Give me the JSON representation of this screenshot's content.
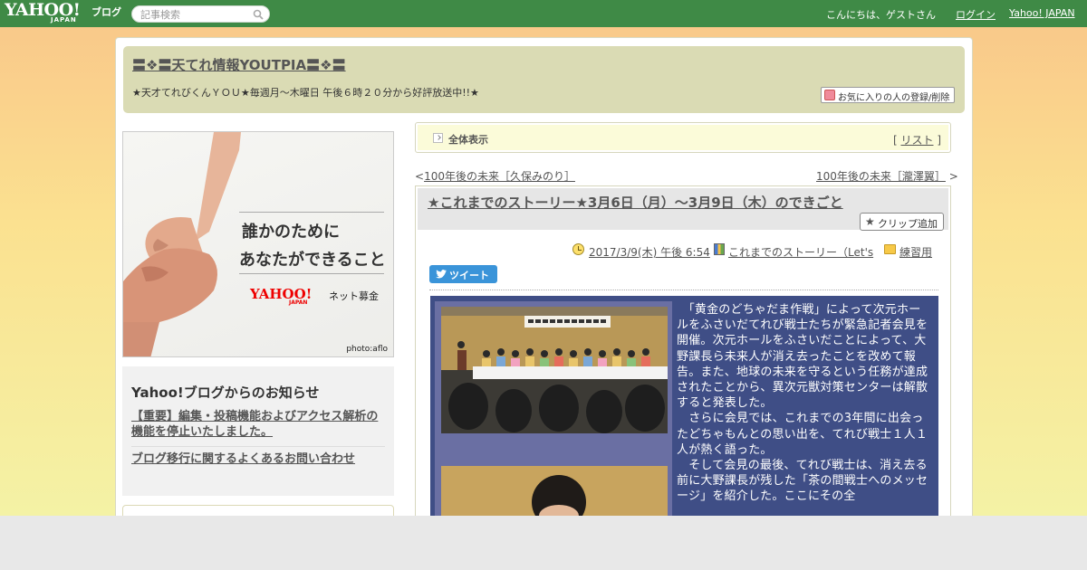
{
  "topbar": {
    "logo_main": "YAHOO!",
    "logo_sub": "JAPAN",
    "logo_blog": "ブログ",
    "search_placeholder": "記事検索",
    "greeting": "こんにちは、ゲストさん",
    "login": "ログイン",
    "yahoo_japan": "Yahoo! JAPAN"
  },
  "header": {
    "blog_title": "〓❖〓天てれ情報YOUTPIA〓❖〓",
    "description": "★天才てれびくんＹＯＵ★毎週月～木曜日 午後６時２０分から好評放送中!!★",
    "fav_button": "お気に入りの人の登録/削除"
  },
  "banner": {
    "line1": "誰かのために",
    "line2": "あなたができること",
    "logo": "YAHOO!",
    "logo_sub": "JAPAN",
    "net_label": "ネット募金",
    "credit": "photo:aflo"
  },
  "notice": {
    "heading": "Yahoo!ブログからのお知らせ",
    "links": [
      "【重要】編集・投稿機能およびアクセス解析の機能を停止いたしました。",
      "ブログ移行に関するよくあるお問い合わせ"
    ]
  },
  "article_nav": {
    "all_label": "全体表示",
    "list_open": "[",
    "list_link": "リスト",
    "list_close": "]",
    "prev_arrow": "<",
    "prev_link": "100年後の未来［久保みのり］",
    "next_link": "100年後の未来［瀧澤翼］",
    "next_arrow": ">"
  },
  "article": {
    "title": "★これまでのストーリー★3月6日（月）～3月9日（木）のできごと",
    "clip_button": "クリップ追加",
    "date": "2017/3/9(木) 午後 6:54",
    "category": "これまでのストーリー（Let's",
    "folder": "練習用",
    "tweet": "ツイート",
    "body": [
      "　「黄金のどちゃだま作戦」によって次元ホールをふさいだてれび戦士たちが緊急記者会見を開催。次元ホールをふさいだことによって、大野課長ら未来人が消え去ったことを改めて報告。また、地球の未来を守るという任務が達成されたことから、異次元獣対策センターは解散すると発表した。",
      "　さらに会見では、これまでの3年間に出会ったどちゃもんとの思い出を、てれび戦士１人１人が熱く語った。",
      "　そして会見の最後、てれび戦士は、消え去る前に大野課長が残した「茶の間戦士へのメッセージ」を紹介した。ここにその全"
    ]
  },
  "colors": {
    "topbar": "#3f8a46",
    "header_bg": "#dadbb4",
    "content_bg": "#3f4e86",
    "tweet": "#3a94d9"
  }
}
